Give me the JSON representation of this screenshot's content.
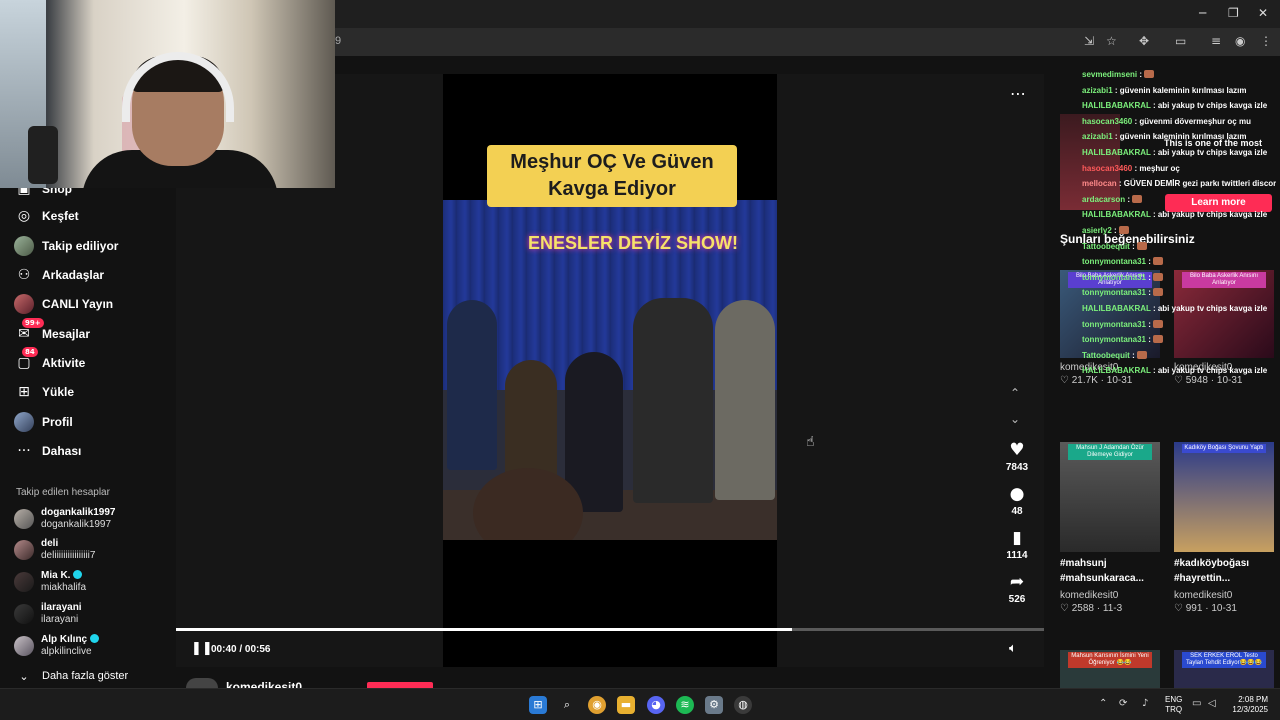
{
  "browser": {
    "url_fragment": "9",
    "window_controls": [
      "─",
      "❐",
      "✕"
    ]
  },
  "sidebar": {
    "items": [
      {
        "label": "Shop",
        "icon": "shop-icon"
      },
      {
        "label": "Keşfet",
        "icon": "compass-icon"
      },
      {
        "label": "Takip ediliyor",
        "icon": "following-avatar-icon"
      },
      {
        "label": "Arkadaşlar",
        "icon": "friends-icon"
      },
      {
        "label": "CANLI Yayın",
        "icon": "live-avatar-icon"
      },
      {
        "label": "Mesajlar",
        "icon": "messages-icon",
        "badge": "99+"
      },
      {
        "label": "Aktivite",
        "icon": "activity-icon",
        "badge": "84"
      },
      {
        "label": "Yükle",
        "icon": "upload-icon"
      },
      {
        "label": "Profil",
        "icon": "profile-avatar-icon"
      },
      {
        "label": "Dahası",
        "icon": "more-icon"
      }
    ],
    "following_title": "Takip edilen hesaplar",
    "accounts": [
      {
        "name": "dogankalik1997",
        "handle": "dogankalik1997",
        "verified": false
      },
      {
        "name": "deli",
        "handle": "deliiiiiiiiiiiiiiii7",
        "verified": false
      },
      {
        "name": "Mia K.",
        "handle": "miakhalifa",
        "verified": true
      },
      {
        "name": "ilarayani",
        "handle": "ilarayani",
        "verified": false
      },
      {
        "name": "Alp Kılınç",
        "handle": "alpkilinclive",
        "verified": true
      }
    ],
    "show_more": "Daha fazla göster"
  },
  "player": {
    "caption": "Meşhur OÇ Ve Güven Kavga Ediyor",
    "neon_sign": "ENESLER DEYİZ SHOW!",
    "likes": "7843",
    "comments": "48",
    "saves": "1114",
    "shares": "526",
    "time": "00:40 / 00:56",
    "progress": 0.71,
    "author_peek": "komedikesit0"
  },
  "ad": {
    "text": "This is one of the most",
    "learn_more": "Learn more"
  },
  "suggestions": {
    "title": "Şunları beğenebilirsiniz",
    "videos": [
      {
        "tag": "Bilo Baba Askerlik Anısını Anlatıyor",
        "author": "komedikesit0",
        "likes": "21.7K",
        "date": "10-31",
        "title": ""
      },
      {
        "tag": "Bilo Baba Askerlik Anısını Anlatıyor",
        "author": "komedikesit0",
        "likes": "5948",
        "date": "10-31",
        "title": ""
      },
      {
        "tag": "Mahsun J Adamdan Özür Dilemeye Gidiyor",
        "author": "komedikesit0",
        "likes": "2588",
        "date": "11-3",
        "title": "#mahsunj #mahsunkaraca..."
      },
      {
        "tag": "Kadıköy Boğası Şovunu Yaptı",
        "author": "komedikesit0",
        "likes": "991",
        "date": "10-31",
        "title": "#kadıköyboğası #hayrettin..."
      },
      {
        "tag": "Mahsun Karısının İsmini Yeni Öğreniyor 😂😂",
        "author": "",
        "likes": "",
        "date": "",
        "title": ""
      },
      {
        "tag": "SEK ERKEK EROL Testo Taylan Tehdit Ediyor😂😂😂",
        "author": "",
        "likes": "",
        "date": "",
        "title": ""
      }
    ]
  },
  "chat": [
    {
      "user": "sevmedimseni",
      "color": "#7cf07c",
      "msg": ""
    },
    {
      "user": "azizabi1",
      "color": "#7cf07c",
      "msg": "güvenin kaleminin kırılması lazım"
    },
    {
      "user": "HALILBABAKRAL",
      "color": "#7cf07c",
      "msg": "abi yakup tv chips kavga izle"
    },
    {
      "user": "hasocan3460",
      "color": "#7cf07c",
      "msg": "güvenmi dövermeşhur oç mu"
    },
    {
      "user": "azizabi1",
      "color": "#7cf07c",
      "msg": "güvenin kaleminin kırılması lazım"
    },
    {
      "user": "HALILBABAKRAL",
      "color": "#7cf07c",
      "msg": "abi yakup tv chips kavga izle"
    },
    {
      "user": "hasocan3460",
      "color": "#ff5a5a",
      "msg": "meşhur oç"
    },
    {
      "user": "mellocan",
      "color": "#ff8a8a",
      "msg": "GÜVEN DEMİR gezi parkı twittleri discordda"
    },
    {
      "user": "ardacarson",
      "color": "#7cf07c",
      "msg": ""
    },
    {
      "user": "HALILBABAKRAL",
      "color": "#7cf07c",
      "msg": "abi yakup tv chips kavga izle"
    },
    {
      "user": "asierly2",
      "color": "#7cf07c",
      "msg": ""
    },
    {
      "user": "Tattoobequit",
      "color": "#7cf07c",
      "msg": ""
    },
    {
      "user": "tonnymontana31",
      "color": "#7cf07c",
      "msg": ""
    },
    {
      "user": "tonnymontana31",
      "color": "#7cf07c",
      "msg": ""
    },
    {
      "user": "tonnymontana31",
      "color": "#7cf07c",
      "msg": ""
    },
    {
      "user": "HALILBABAKRAL",
      "color": "#7cf07c",
      "msg": "abi yakup tv chips kavga izle"
    },
    {
      "user": "tonnymontana31",
      "color": "#7cf07c",
      "msg": ""
    },
    {
      "user": "tonnymontana31",
      "color": "#7cf07c",
      "msg": ""
    },
    {
      "user": "Tattoobequit",
      "color": "#7cf07c",
      "msg": ""
    },
    {
      "user": "HALILBABAKRAL",
      "color": "#7cf07c",
      "msg": "abi yakup tv chips kavga izle"
    }
  ],
  "taskbar": {
    "lang": "ENG",
    "lang2": "TRQ",
    "time": "2:08 PM",
    "date": "12/3/2025"
  },
  "colors": {
    "accent": "#fe2c55",
    "caption_bg": "#f3d053",
    "chat_user": "#7cf07c"
  }
}
